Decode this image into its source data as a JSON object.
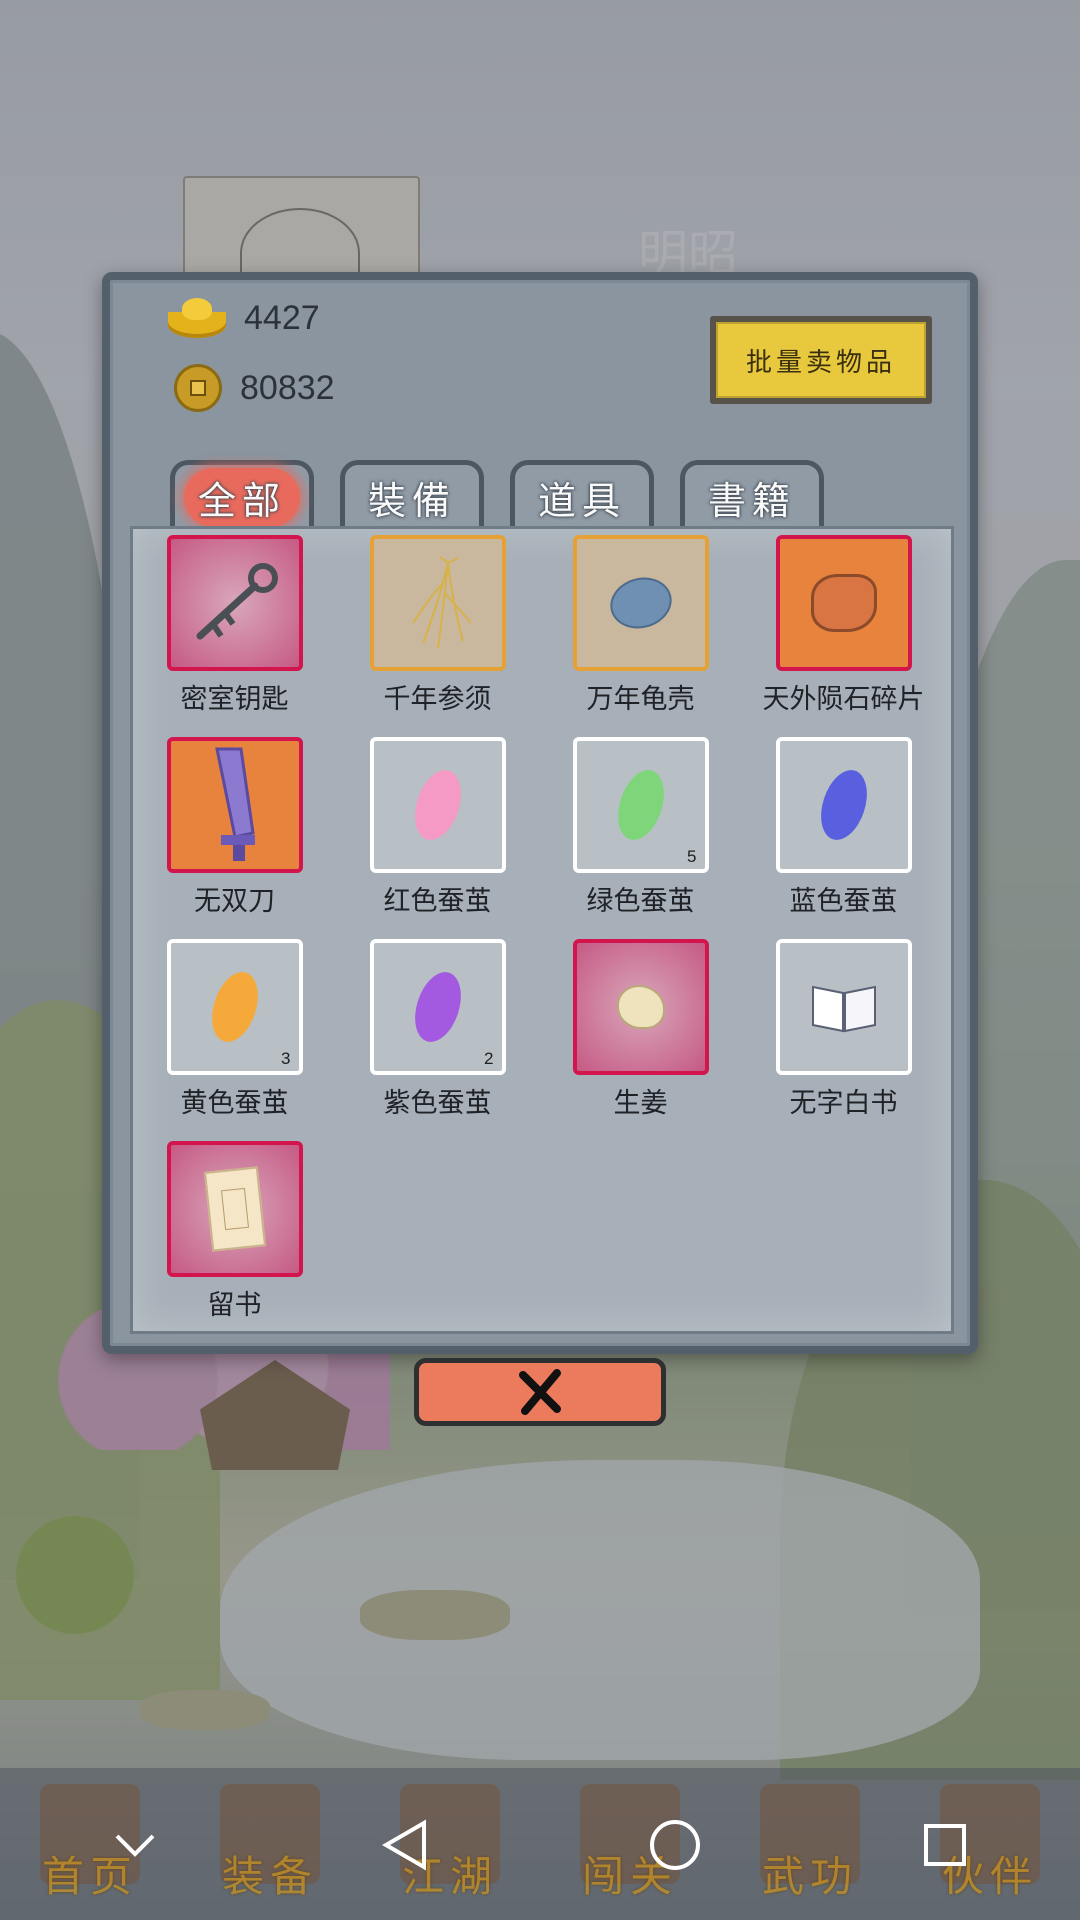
{
  "character": {
    "name": "明昭"
  },
  "currency": {
    "gold_ingot": "4427",
    "copper_coin": "80832"
  },
  "batch_sell_label": "批量卖物品",
  "tabs": [
    {
      "label": "全部",
      "active": true
    },
    {
      "label": "裝備",
      "active": false
    },
    {
      "label": "道具",
      "active": false
    },
    {
      "label": "書籍",
      "active": false
    }
  ],
  "items": [
    {
      "name": "密室钥匙",
      "rarity": "red",
      "icon": "key-icon",
      "qty": ""
    },
    {
      "name": "千年参须",
      "rarity": "orange",
      "icon": "ginseng-icon",
      "qty": ""
    },
    {
      "name": "万年龟壳",
      "rarity": "orange",
      "icon": "turtle-shell-icon",
      "qty": ""
    },
    {
      "name": "天外陨石碎片",
      "rarity": "orangefill",
      "icon": "meteorite-icon",
      "qty": ""
    },
    {
      "name": "无双刀",
      "rarity": "orangefill",
      "icon": "sword-icon",
      "qty": ""
    },
    {
      "name": "红色蚕茧",
      "rarity": "white",
      "icon": "pink-cocoon-icon",
      "qty": "",
      "color": "#f59ac4"
    },
    {
      "name": "绿色蚕茧",
      "rarity": "white",
      "icon": "green-cocoon-icon",
      "qty": "5",
      "color": "#7fd67a"
    },
    {
      "name": "蓝色蚕茧",
      "rarity": "white",
      "icon": "blue-cocoon-icon",
      "qty": "",
      "color": "#5860e0"
    },
    {
      "name": "黄色蚕茧",
      "rarity": "white",
      "icon": "yellow-cocoon-icon",
      "qty": "3",
      "color": "#f4a93a"
    },
    {
      "name": "紫色蚕茧",
      "rarity": "white",
      "icon": "purple-cocoon-icon",
      "qty": "2",
      "color": "#a45ae0"
    },
    {
      "name": "生姜",
      "rarity": "red",
      "icon": "ginger-icon",
      "qty": ""
    },
    {
      "name": "无字白书",
      "rarity": "white",
      "icon": "book-icon",
      "qty": ""
    },
    {
      "name": "留书",
      "rarity": "red",
      "icon": "letter-icon",
      "qty": ""
    }
  ],
  "bottom_nav": [
    {
      "label": "首页"
    },
    {
      "label": "装备"
    },
    {
      "label": "江湖"
    },
    {
      "label": "闯关"
    },
    {
      "label": "武功"
    },
    {
      "label": "伙伴"
    }
  ],
  "colors": {
    "panel": "#8a95a0",
    "rarity_red": "#d3154d",
    "rarity_orange": "#e5a136",
    "close_button": "#ec7a5c",
    "active_tab": "#e86a5c"
  }
}
